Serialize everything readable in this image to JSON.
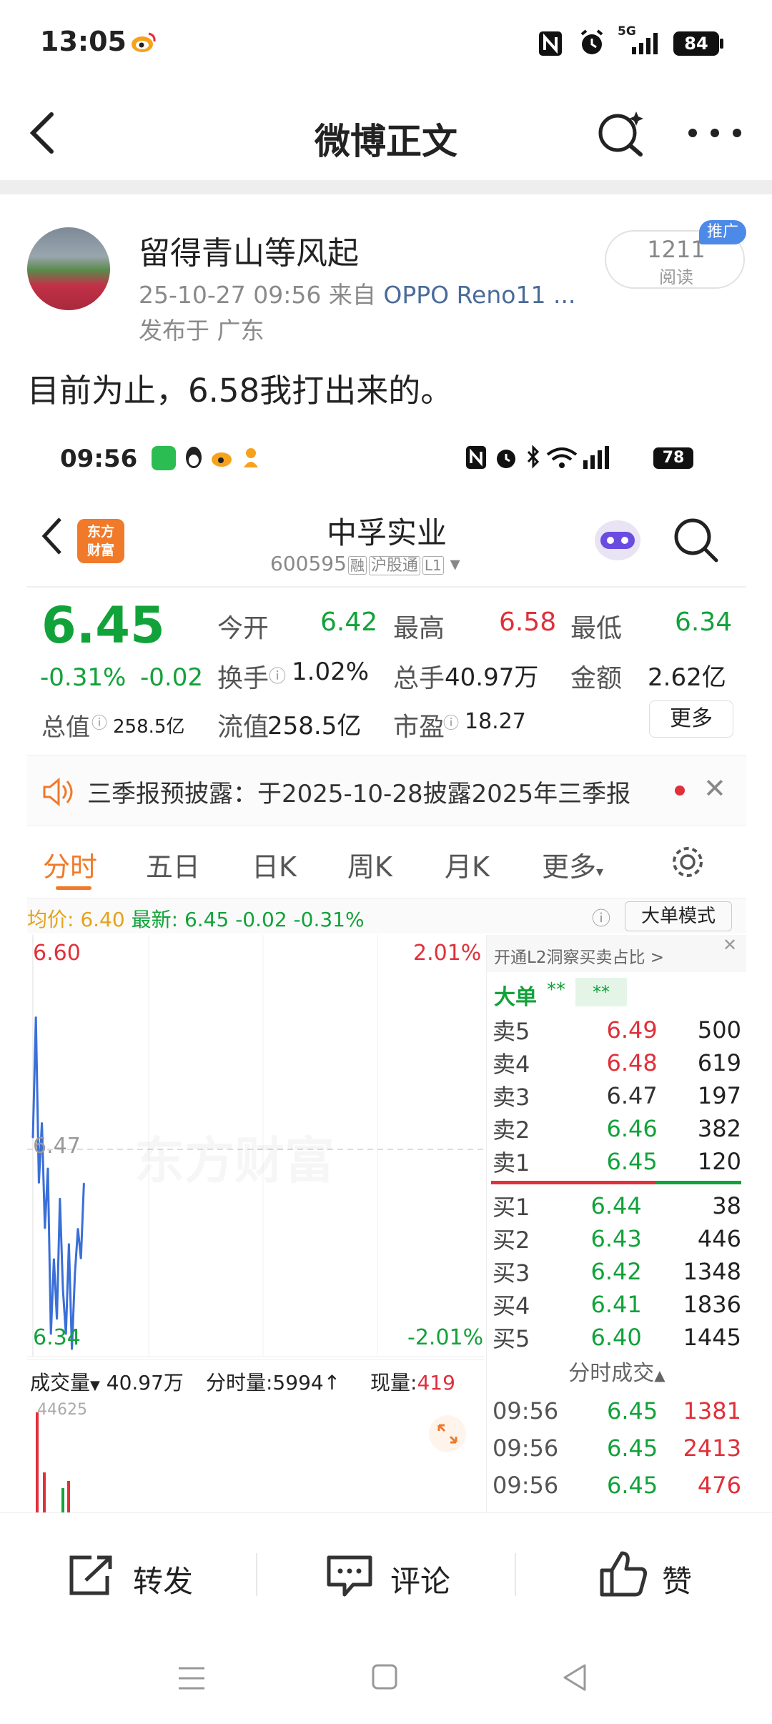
{
  "status_bar": {
    "time": "13:05",
    "signal": "5G",
    "battery": "84"
  },
  "header": {
    "title": "微博正文"
  },
  "post": {
    "username": "留得青山等风起",
    "meta": "25-10-27 09:56 来自",
    "device": "OPPO Reno11 ...",
    "location": "发布于 广东",
    "read_count": "1211",
    "read_label": "阅读",
    "promo_badge": "推广",
    "text": "目前为止，6.58我打出来的。"
  },
  "screenshot": {
    "status": {
      "time": "09:56",
      "battery": "78"
    },
    "stock": {
      "name": "中孚实业",
      "code": "600595",
      "tags": [
        "融",
        "沪股通",
        "L1"
      ],
      "logo": [
        "东方",
        "财富"
      ],
      "price": "6.45",
      "change_pct": "-0.31%",
      "change": "-0.02",
      "stats": {
        "open_label": "今开",
        "open": "6.42",
        "high_label": "最高",
        "high": "6.58",
        "low_label": "最低",
        "low": "6.34",
        "turnover_label": "换手",
        "turnover": "1.02%",
        "volume_label": "总手",
        "volume": "40.97万",
        "amount_label": "金额",
        "amount": "2.62亿",
        "mktcap_label": "总值",
        "mktcap": "258.5亿",
        "float_label": "流值",
        "float": "258.5亿",
        "pe_label": "市盈",
        "pe": "18.27",
        "more": "更多"
      }
    },
    "notice": "三季报预披露：于2025-10-28披露2025年三季报",
    "tabs": [
      "分时",
      "五日",
      "日K",
      "周K",
      "月K",
      "更多"
    ],
    "price_line": {
      "avg_label": "均价:",
      "avg": "6.40",
      "latest_label": "最新:",
      "latest": "6.45",
      "change": "-0.02",
      "pct": "-0.31%",
      "mode": "大单模式"
    },
    "chart": {
      "y_top": "6.60",
      "y_mid": "6.47",
      "y_bottom": "6.34",
      "pct_top": "2.01%",
      "pct_bottom": "-2.01%",
      "watermark": "东方财富",
      "volume_label": "成交量",
      "volume_total": "40.97万",
      "minute_vol": "分时量:5994↑",
      "now_label": "现量:",
      "now_vol": "419",
      "vol_axis": "44625"
    },
    "chart_data": {
      "type": "line",
      "series": [
        {
          "values": [
            6.48,
            6.56,
            6.45,
            6.49,
            6.42,
            6.46,
            6.35,
            6.4,
            6.36,
            6.44,
            6.38,
            6.35,
            6.41,
            6.34,
            6.39,
            6.42,
            6.4,
            6.45
          ]
        }
      ],
      "ylim": [
        6.34,
        6.6
      ]
    },
    "orderbook": {
      "promo": "开通L2洞察买卖占比 >",
      "bigorder_label": "大单",
      "bigorder_stars": "**",
      "bigorder_box": "**",
      "sells": [
        {
          "label": "卖5",
          "price": "6.49",
          "qty": "500"
        },
        {
          "label": "卖4",
          "price": "6.48",
          "qty": "619"
        },
        {
          "label": "卖3",
          "price": "6.47",
          "qty": "197"
        },
        {
          "label": "卖2",
          "price": "6.46",
          "qty": "382"
        },
        {
          "label": "卖1",
          "price": "6.45",
          "qty": "120"
        }
      ],
      "buys": [
        {
          "label": "买1",
          "price": "6.44",
          "qty": "38"
        },
        {
          "label": "买2",
          "price": "6.43",
          "qty": "446"
        },
        {
          "label": "买3",
          "price": "6.42",
          "qty": "1348"
        },
        {
          "label": "买4",
          "price": "6.41",
          "qty": "1836"
        },
        {
          "label": "买5",
          "price": "6.40",
          "qty": "1445"
        }
      ],
      "ticks_label": "分时成交",
      "ticks": [
        {
          "time": "09:56",
          "price": "6.45",
          "qty": "1381"
        },
        {
          "time": "09:56",
          "price": "6.45",
          "qty": "2413"
        },
        {
          "time": "09:56",
          "price": "6.45",
          "qty": "476"
        }
      ]
    }
  },
  "actions": {
    "repost": "转发",
    "comment": "评论",
    "like": "赞"
  },
  "colors": {
    "up": "#e0303a",
    "down": "#12a23a",
    "accent_orange": "#f07a2a",
    "weibo_blue": "#4d8ae8"
  }
}
